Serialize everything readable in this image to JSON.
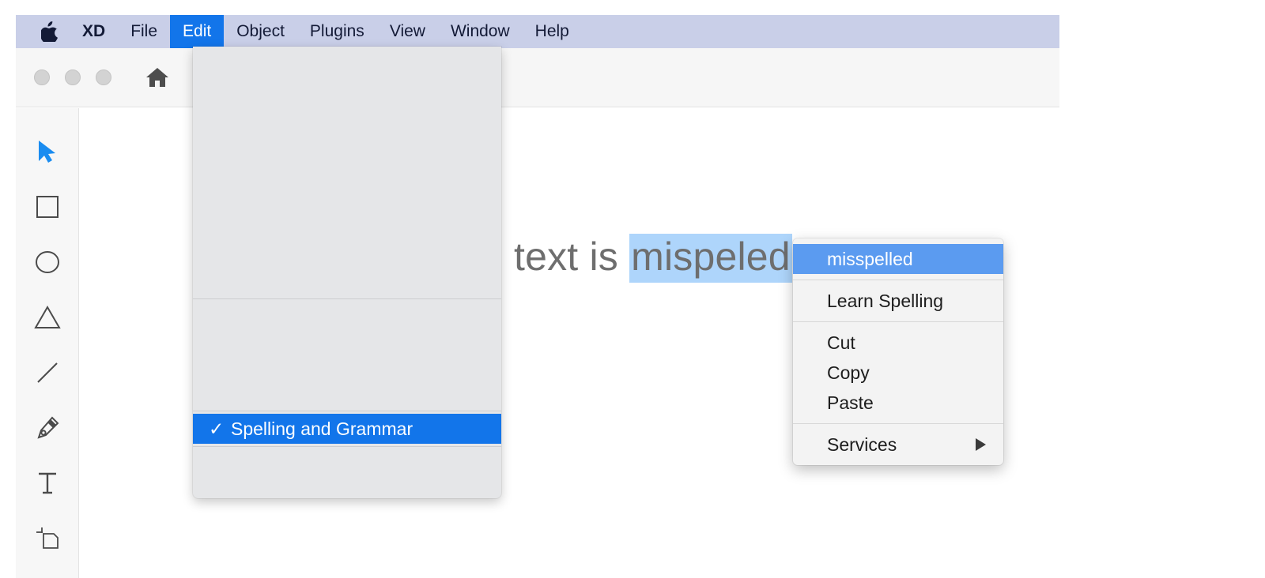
{
  "menubar": {
    "apple_icon": "apple-logo-icon",
    "items": [
      {
        "label": "XD",
        "bold": true,
        "active": false
      },
      {
        "label": "File",
        "bold": false,
        "active": false
      },
      {
        "label": "Edit",
        "bold": false,
        "active": true
      },
      {
        "label": "Object",
        "bold": false,
        "active": false
      },
      {
        "label": "Plugins",
        "bold": false,
        "active": false
      },
      {
        "label": "View",
        "bold": false,
        "active": false
      },
      {
        "label": "Window",
        "bold": false,
        "active": false
      },
      {
        "label": "Help",
        "bold": false,
        "active": false
      }
    ],
    "background_color": "#c9cfe8",
    "active_color": "#1275ea"
  },
  "window": {
    "traffic_lights": [
      "close-button",
      "minimize-button",
      "zoom-button"
    ],
    "home_icon": "home-icon"
  },
  "toolbar": {
    "tools": [
      {
        "name": "select-tool",
        "icon": "cursor-arrow-icon",
        "selected": true
      },
      {
        "name": "rectangle-tool",
        "icon": "square-icon",
        "selected": false
      },
      {
        "name": "ellipse-tool",
        "icon": "circle-icon",
        "selected": false
      },
      {
        "name": "polygon-tool",
        "icon": "triangle-icon",
        "selected": false
      },
      {
        "name": "line-tool",
        "icon": "line-icon",
        "selected": false
      },
      {
        "name": "pen-tool",
        "icon": "pen-nib-icon",
        "selected": false
      },
      {
        "name": "text-tool",
        "icon": "text-t-icon",
        "selected": false
      },
      {
        "name": "artboard-tool",
        "icon": "artboard-icon",
        "selected": false
      }
    ],
    "selected_color": "#1a8cf0"
  },
  "canvas": {
    "text_before": "text is ",
    "selected_word": "mispeled",
    "selection_color": "#aed5fb",
    "text_color": "#6e6e6e"
  },
  "edit_menu": {
    "highlight_item": {
      "check": "✓",
      "label": "Spelling and Grammar"
    },
    "highlight_color": "#1275ea",
    "background_color": "#e5e6e8"
  },
  "context_menu": {
    "items": [
      {
        "label": "misspelled",
        "highlight": true,
        "submenu": false
      },
      {
        "label": "Learn Spelling",
        "highlight": false,
        "submenu": false
      },
      {
        "label": "Cut",
        "highlight": false,
        "submenu": false
      },
      {
        "label": "Copy",
        "highlight": false,
        "submenu": false
      },
      {
        "label": "Paste",
        "highlight": false,
        "submenu": false
      },
      {
        "label": "Services",
        "highlight": false,
        "submenu": true
      }
    ],
    "highlight_color": "#5b9bf0",
    "background_color": "#f3f3f3"
  }
}
